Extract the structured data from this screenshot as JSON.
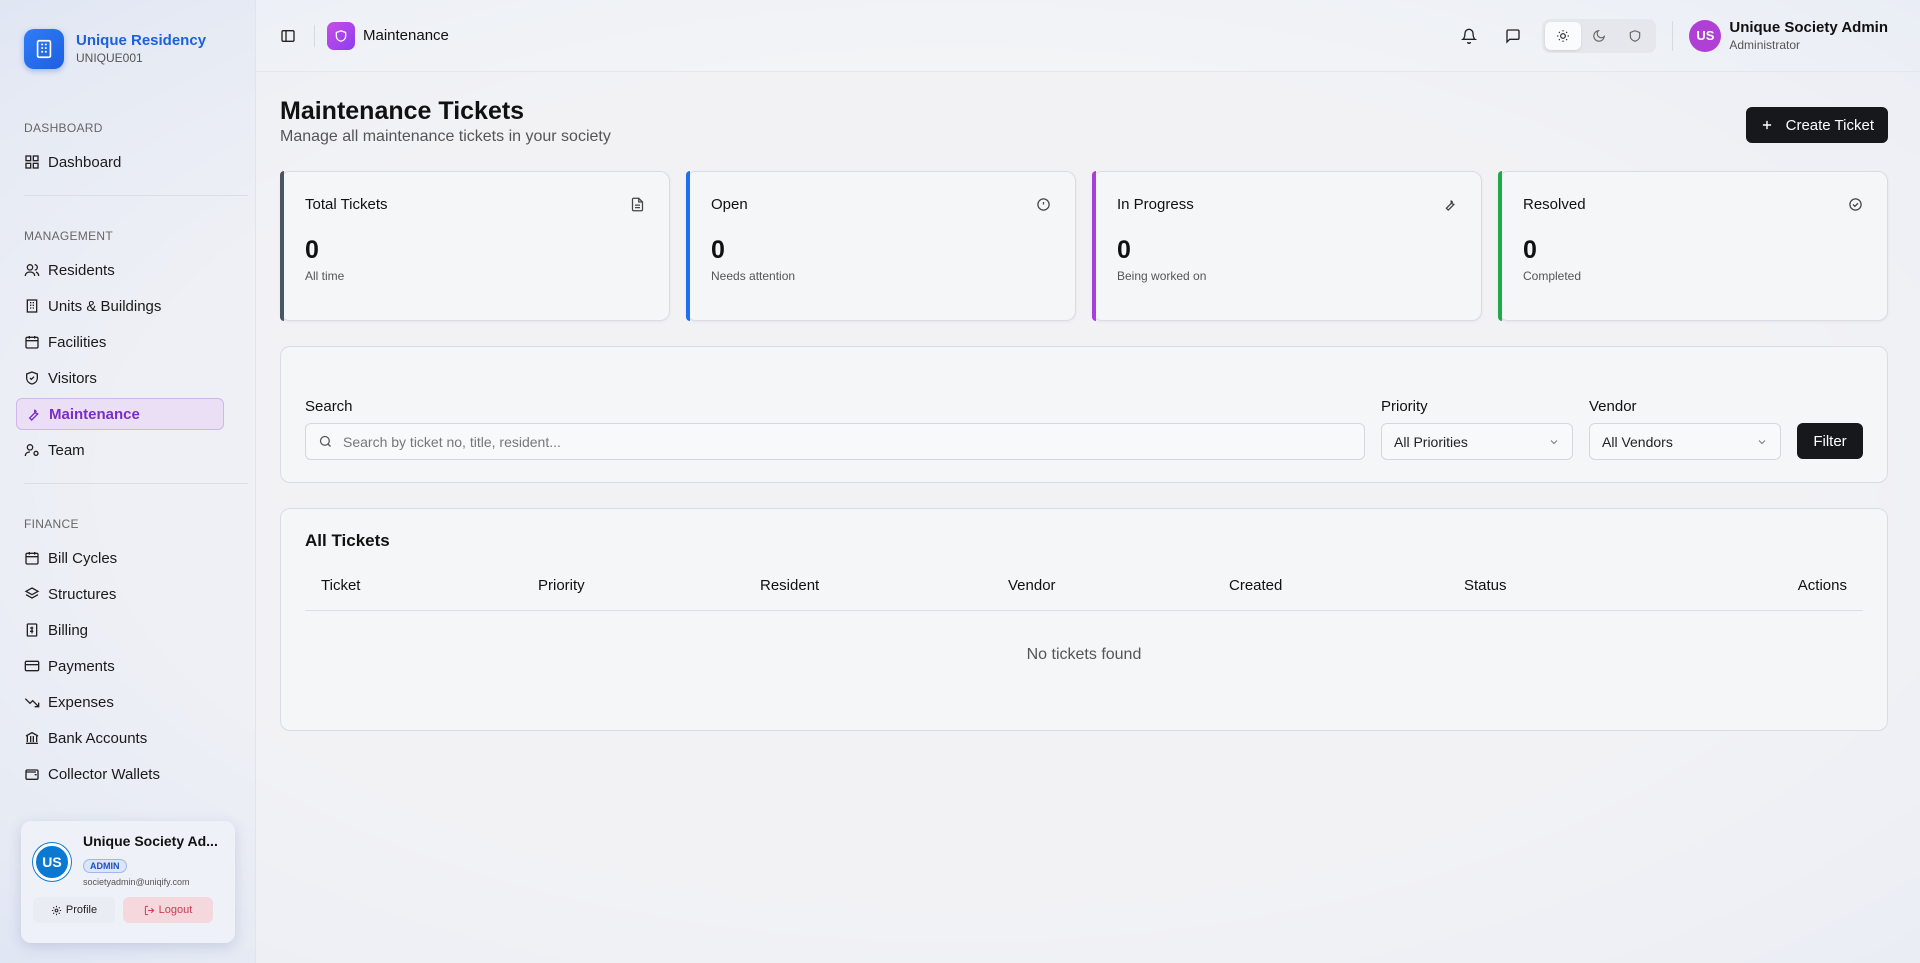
{
  "brand": {
    "name": "Unique Residency",
    "code": "UNIQUE001"
  },
  "sidebar": {
    "sections": [
      {
        "heading": "DASHBOARD",
        "items": [
          {
            "label": "Dashboard",
            "icon": "grid-icon"
          }
        ]
      },
      {
        "heading": "MANAGEMENT",
        "items": [
          {
            "label": "Residents",
            "icon": "users-icon"
          },
          {
            "label": "Units & Buildings",
            "icon": "building-icon"
          },
          {
            "label": "Facilities",
            "icon": "calendar-icon"
          },
          {
            "label": "Visitors",
            "icon": "shield-check-icon"
          },
          {
            "label": "Maintenance",
            "icon": "wrench-icon",
            "active": true
          },
          {
            "label": "Team",
            "icon": "user-cog-icon"
          }
        ]
      },
      {
        "heading": "FINANCE",
        "items": [
          {
            "label": "Bill Cycles",
            "icon": "calendar-icon"
          },
          {
            "label": "Structures",
            "icon": "layers-icon"
          },
          {
            "label": "Billing",
            "icon": "receipt-icon"
          },
          {
            "label": "Payments",
            "icon": "credit-card-icon"
          },
          {
            "label": "Expenses",
            "icon": "trending-down-icon"
          },
          {
            "label": "Bank Accounts",
            "icon": "bank-icon"
          },
          {
            "label": "Collector Wallets",
            "icon": "wallet-icon"
          }
        ]
      }
    ]
  },
  "user_card": {
    "initials": "US",
    "name": "Unique Society Ad...",
    "badge": "ADMIN",
    "email": "societyadmin@uniqify.com",
    "profile_label": "Profile",
    "logout_label": "Logout"
  },
  "topbar": {
    "title": "Maintenance",
    "user_initials": "US",
    "user_name": "Unique Society Admin",
    "user_role": "Administrator"
  },
  "page": {
    "title": "Maintenance Tickets",
    "subtitle": "Manage all maintenance tickets in your society",
    "create_label": "Create Ticket"
  },
  "stats": [
    {
      "label": "Total Tickets",
      "value": "0",
      "note": "All time",
      "color": "#4a5568",
      "icon": "file-icon"
    },
    {
      "label": "Open",
      "value": "0",
      "note": "Needs attention",
      "color": "#1f6ff0",
      "icon": "alert-circle-icon"
    },
    {
      "label": "In Progress",
      "value": "0",
      "note": "Being worked on",
      "color": "#a63ee0",
      "icon": "wrench-icon"
    },
    {
      "label": "Resolved",
      "value": "0",
      "note": "Completed",
      "color": "#1faa4a",
      "icon": "check-circle-icon"
    }
  ],
  "filters": {
    "search_label": "Search",
    "search_placeholder": "Search by ticket no, title, resident...",
    "priority_label": "Priority",
    "priority_value": "All Priorities",
    "vendor_label": "Vendor",
    "vendor_value": "All Vendors",
    "filter_label": "Filter"
  },
  "table": {
    "title": "All Tickets",
    "columns": [
      "Ticket",
      "Priority",
      "Resident",
      "Vendor",
      "Created",
      "Status",
      "Actions"
    ],
    "empty": "No tickets found"
  }
}
